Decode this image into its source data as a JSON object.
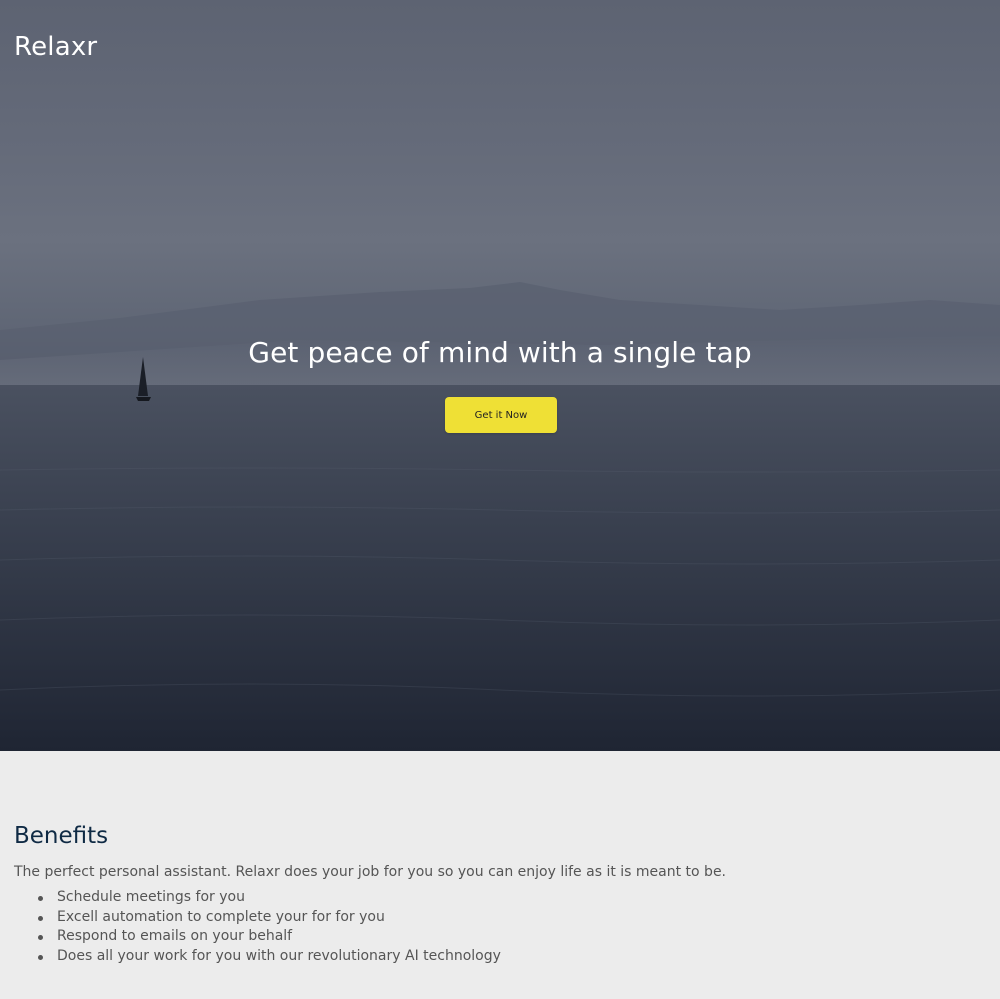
{
  "brand": {
    "logo_text": "Relaxr"
  },
  "hero": {
    "headline": "Get peace of mind with a single tap",
    "cta_label": "Get it Now",
    "cta_color": "#efe035"
  },
  "benefits": {
    "title": "Benefits",
    "intro": "The perfect personal assistant. Relaxr does your job for you so you can enjoy life as it is meant to be.",
    "items": [
      "Schedule meetings for you",
      "Excell automation to complete your for for you",
      "Respond to emails on your behalf",
      "Does all your work for you with our revolutionary AI technology"
    ]
  }
}
